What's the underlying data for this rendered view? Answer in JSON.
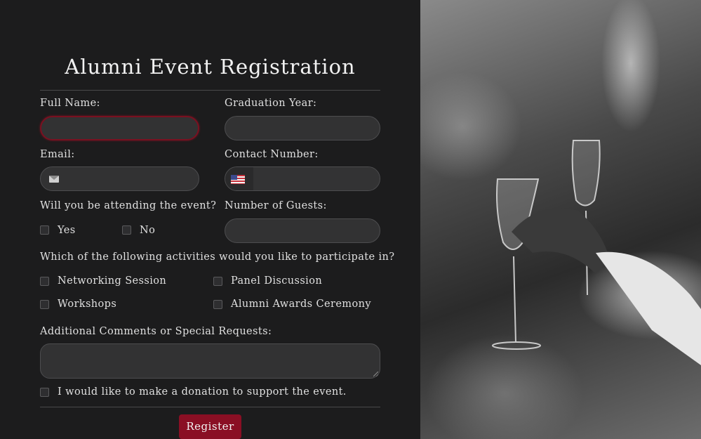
{
  "form": {
    "title": "Alumni Event Registration",
    "full_name_label": "Full Name:",
    "full_name_value": "",
    "graduation_year_label": "Graduation Year:",
    "graduation_year_value": "",
    "email_label": "Email:",
    "email_value": "",
    "contact_label": "Contact Number:",
    "contact_value": "",
    "attending_label": "Will you be attending the event?",
    "attending_options": [
      "Yes",
      "No"
    ],
    "guests_label": "Number of Guests:",
    "guests_value": "",
    "activities_label": "Which of the following activities would you like to participate in?",
    "activities": [
      "Networking Session",
      "Panel Discussion",
      "Workshops",
      "Alumni Awards Ceremony"
    ],
    "comments_label": "Additional Comments or Special Requests:",
    "comments_value": "",
    "donation_label": "I would like to make a donation to support the event.",
    "register_button": "Register"
  },
  "icons": {
    "email": "envelope-icon",
    "phone_country": "us-flag-icon"
  },
  "colors": {
    "background": "#1c1c1d",
    "accent": "#8a0f24",
    "field": "#323233"
  }
}
